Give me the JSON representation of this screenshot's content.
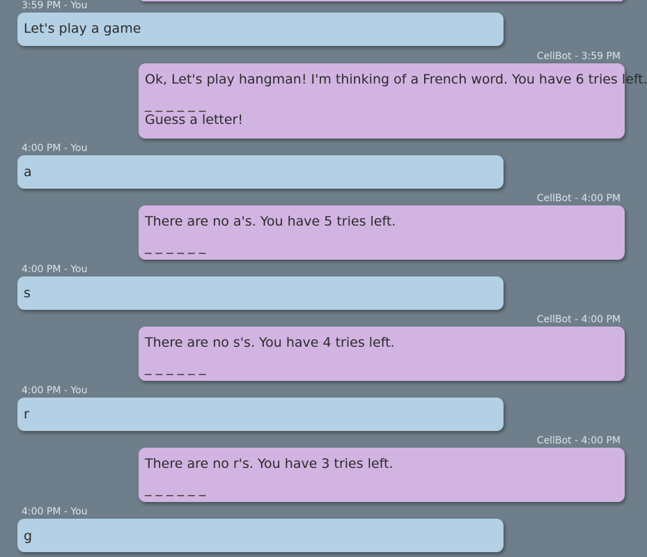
{
  "messages": [
    {
      "sender": "user",
      "meta": "3:59 PM - You",
      "text": "Let's play a game"
    },
    {
      "sender": "bot",
      "meta": "CellBot - 3:59 PM",
      "text": "Ok, Let's play hangman! I'm thinking of a French word. You have 6 tries left.",
      "blanks": "_ _ _ _ _ _",
      "prompt": "Guess a letter!"
    },
    {
      "sender": "user",
      "meta": "4:00 PM - You",
      "text": "a"
    },
    {
      "sender": "bot",
      "meta": "CellBot - 4:00 PM",
      "text": "There are no a's. You have 5 tries left.",
      "blanks": "_ _ _ _ _ _"
    },
    {
      "sender": "user",
      "meta": "4:00 PM - You",
      "text": "s"
    },
    {
      "sender": "bot",
      "meta": "CellBot - 4:00 PM",
      "text": "There are no s's. You have 4 tries left.",
      "blanks": "_ _ _ _ _ _"
    },
    {
      "sender": "user",
      "meta": "4:00 PM - You",
      "text": "r"
    },
    {
      "sender": "bot",
      "meta": "CellBot - 4:00 PM",
      "text": "There are no r's. You have 3 tries left.",
      "blanks": "_ _ _ _ _ _"
    },
    {
      "sender": "user",
      "meta": "4:00 PM - You",
      "text": "g"
    }
  ],
  "colors": {
    "background": "#6e7e8a",
    "user_bubble": "#b3d0e4",
    "bot_bubble": "#d2b4e2",
    "meta_text": "#dde3e8"
  }
}
